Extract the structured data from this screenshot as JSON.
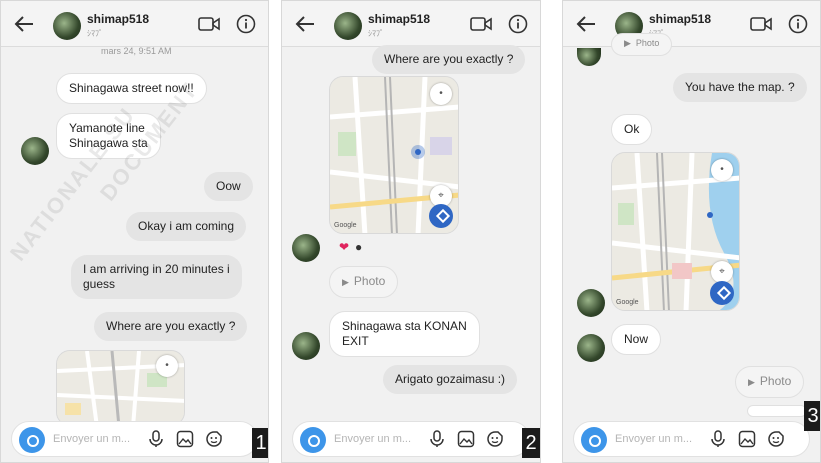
{
  "panels": [
    {
      "header": {
        "name": "shimap518",
        "sub": "ｼﾏﾌﾟ"
      },
      "timestamp": "mars 24, 9:51 AM",
      "messages": [
        "Shinagawa street now!!",
        "Yamanote line",
        "Shinagawa sta",
        "Oow",
        "Okay i am coming",
        "I am arriving in 20 minutes i",
        "guess",
        "Where are you exactly ?"
      ],
      "input_placeholder": "Envoyer un m...",
      "step": "1"
    },
    {
      "header": {
        "name": "shimap518",
        "sub": "ｼﾏﾌﾟ"
      },
      "messages": [
        "Where are you exactly ?",
        "Photo",
        "Shinagawa sta KONAN",
        "EXIT",
        "Arigato gozaimasu :)"
      ],
      "reactions": [
        "❤",
        "●"
      ],
      "input_placeholder": "Envoyer un m...",
      "step": "2"
    },
    {
      "header": {
        "name": "shimap518",
        "sub": "ｼﾏﾌﾟ"
      },
      "messages": [
        "Photo",
        "You have the map. ?",
        "Ok",
        "Now",
        "Photo"
      ],
      "input_placeholder": "Envoyer un m...",
      "step": "3"
    }
  ],
  "map_label": "Google",
  "watermark": [
    "NATIONALE SU",
    "DOCUMENT"
  ],
  "icons": [
    "back-arrow-icon",
    "video-call-icon",
    "info-icon",
    "camera-icon",
    "microphone-icon",
    "gallery-icon",
    "sticker-icon"
  ],
  "colors": {
    "accent": "#3d95e9",
    "map_button": "#2f67c4",
    "outgoing_bubble": "#e4e4e4",
    "heart": "#e0245e"
  }
}
